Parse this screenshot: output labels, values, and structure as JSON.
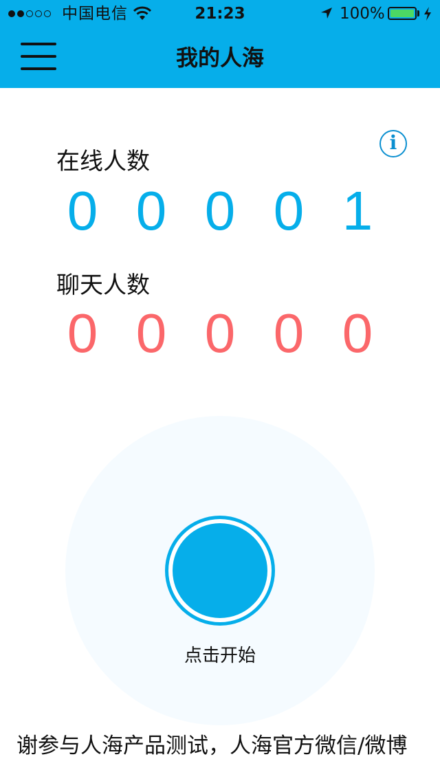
{
  "status_bar": {
    "signal_dots": [
      true,
      true,
      false,
      false,
      false
    ],
    "carrier": "中国电信",
    "wifi_icon": "wifi-icon",
    "time": "21:23",
    "location_icon": "location-arrow-icon",
    "battery_percent_text": "100%",
    "battery_level": 1.0,
    "charging_icon": "charging-bolt-icon"
  },
  "nav": {
    "menu_icon": "hamburger-menu-icon",
    "title": "我的人海"
  },
  "info_button": {
    "icon": "info-icon",
    "glyph": "i"
  },
  "online": {
    "label": "在线人数",
    "digits": [
      "0",
      "0",
      "0",
      "0",
      "1"
    ]
  },
  "chat": {
    "label": "聊天人数",
    "digits": [
      "0",
      "0",
      "0",
      "0",
      "0"
    ]
  },
  "start": {
    "label": "点击开始"
  },
  "footer": {
    "text": "谢参与人海产品测试，人海官方微信/微博"
  },
  "colors": {
    "brand_blue": "#06aeea",
    "chat_red": "#fb676a",
    "info_blue": "#0a8fd0",
    "battery_green": "#4cd964"
  }
}
